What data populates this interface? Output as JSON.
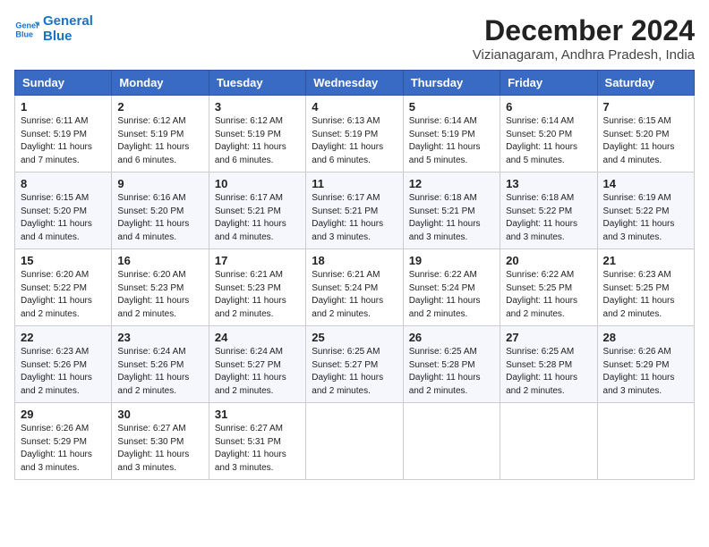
{
  "logo": {
    "line1": "General",
    "line2": "Blue"
  },
  "title": "December 2024",
  "location": "Vizianagaram, Andhra Pradesh, India",
  "days_of_week": [
    "Sunday",
    "Monday",
    "Tuesday",
    "Wednesday",
    "Thursday",
    "Friday",
    "Saturday"
  ],
  "weeks": [
    [
      {
        "day": 1,
        "text": "Sunrise: 6:11 AM\nSunset: 5:19 PM\nDaylight: 11 hours and 7 minutes."
      },
      {
        "day": 2,
        "text": "Sunrise: 6:12 AM\nSunset: 5:19 PM\nDaylight: 11 hours and 6 minutes."
      },
      {
        "day": 3,
        "text": "Sunrise: 6:12 AM\nSunset: 5:19 PM\nDaylight: 11 hours and 6 minutes."
      },
      {
        "day": 4,
        "text": "Sunrise: 6:13 AM\nSunset: 5:19 PM\nDaylight: 11 hours and 6 minutes."
      },
      {
        "day": 5,
        "text": "Sunrise: 6:14 AM\nSunset: 5:19 PM\nDaylight: 11 hours and 5 minutes."
      },
      {
        "day": 6,
        "text": "Sunrise: 6:14 AM\nSunset: 5:20 PM\nDaylight: 11 hours and 5 minutes."
      },
      {
        "day": 7,
        "text": "Sunrise: 6:15 AM\nSunset: 5:20 PM\nDaylight: 11 hours and 4 minutes."
      }
    ],
    [
      {
        "day": 8,
        "text": "Sunrise: 6:15 AM\nSunset: 5:20 PM\nDaylight: 11 hours and 4 minutes."
      },
      {
        "day": 9,
        "text": "Sunrise: 6:16 AM\nSunset: 5:20 PM\nDaylight: 11 hours and 4 minutes."
      },
      {
        "day": 10,
        "text": "Sunrise: 6:17 AM\nSunset: 5:21 PM\nDaylight: 11 hours and 4 minutes."
      },
      {
        "day": 11,
        "text": "Sunrise: 6:17 AM\nSunset: 5:21 PM\nDaylight: 11 hours and 3 minutes."
      },
      {
        "day": 12,
        "text": "Sunrise: 6:18 AM\nSunset: 5:21 PM\nDaylight: 11 hours and 3 minutes."
      },
      {
        "day": 13,
        "text": "Sunrise: 6:18 AM\nSunset: 5:22 PM\nDaylight: 11 hours and 3 minutes."
      },
      {
        "day": 14,
        "text": "Sunrise: 6:19 AM\nSunset: 5:22 PM\nDaylight: 11 hours and 3 minutes."
      }
    ],
    [
      {
        "day": 15,
        "text": "Sunrise: 6:20 AM\nSunset: 5:22 PM\nDaylight: 11 hours and 2 minutes."
      },
      {
        "day": 16,
        "text": "Sunrise: 6:20 AM\nSunset: 5:23 PM\nDaylight: 11 hours and 2 minutes."
      },
      {
        "day": 17,
        "text": "Sunrise: 6:21 AM\nSunset: 5:23 PM\nDaylight: 11 hours and 2 minutes."
      },
      {
        "day": 18,
        "text": "Sunrise: 6:21 AM\nSunset: 5:24 PM\nDaylight: 11 hours and 2 minutes."
      },
      {
        "day": 19,
        "text": "Sunrise: 6:22 AM\nSunset: 5:24 PM\nDaylight: 11 hours and 2 minutes."
      },
      {
        "day": 20,
        "text": "Sunrise: 6:22 AM\nSunset: 5:25 PM\nDaylight: 11 hours and 2 minutes."
      },
      {
        "day": 21,
        "text": "Sunrise: 6:23 AM\nSunset: 5:25 PM\nDaylight: 11 hours and 2 minutes."
      }
    ],
    [
      {
        "day": 22,
        "text": "Sunrise: 6:23 AM\nSunset: 5:26 PM\nDaylight: 11 hours and 2 minutes."
      },
      {
        "day": 23,
        "text": "Sunrise: 6:24 AM\nSunset: 5:26 PM\nDaylight: 11 hours and 2 minutes."
      },
      {
        "day": 24,
        "text": "Sunrise: 6:24 AM\nSunset: 5:27 PM\nDaylight: 11 hours and 2 minutes."
      },
      {
        "day": 25,
        "text": "Sunrise: 6:25 AM\nSunset: 5:27 PM\nDaylight: 11 hours and 2 minutes."
      },
      {
        "day": 26,
        "text": "Sunrise: 6:25 AM\nSunset: 5:28 PM\nDaylight: 11 hours and 2 minutes."
      },
      {
        "day": 27,
        "text": "Sunrise: 6:25 AM\nSunset: 5:28 PM\nDaylight: 11 hours and 2 minutes."
      },
      {
        "day": 28,
        "text": "Sunrise: 6:26 AM\nSunset: 5:29 PM\nDaylight: 11 hours and 3 minutes."
      }
    ],
    [
      {
        "day": 29,
        "text": "Sunrise: 6:26 AM\nSunset: 5:29 PM\nDaylight: 11 hours and 3 minutes."
      },
      {
        "day": 30,
        "text": "Sunrise: 6:27 AM\nSunset: 5:30 PM\nDaylight: 11 hours and 3 minutes."
      },
      {
        "day": 31,
        "text": "Sunrise: 6:27 AM\nSunset: 5:31 PM\nDaylight: 11 hours and 3 minutes."
      },
      null,
      null,
      null,
      null
    ]
  ]
}
